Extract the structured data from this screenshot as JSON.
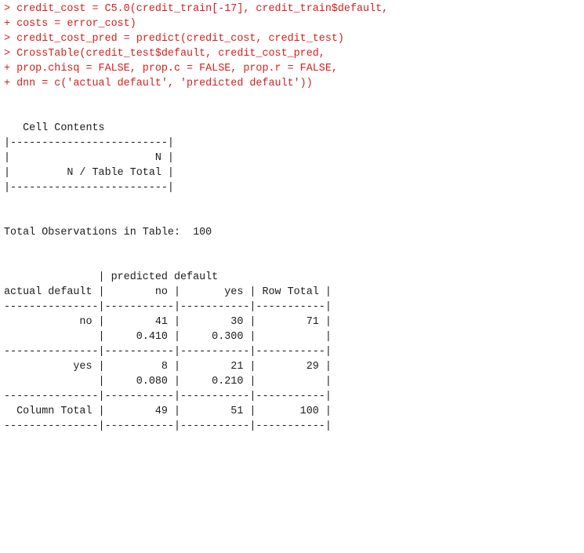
{
  "colors": {
    "command_text": "#d42020",
    "output_text": "#1c1c1c",
    "background": "#ffffff"
  },
  "commands": [
    "> credit_cost = C5.0(credit_train[-17], credit_train$default,",
    "+ costs = error_cost)",
    "> credit_cost_pred = predict(credit_cost, credit_test)",
    "> CrossTable(credit_test$default, credit_cost_pred,",
    "+ prop.chisq = FALSE, prop.c = FALSE, prop.r = FALSE,",
    "+ dnn = c('actual default', 'predicted default'))"
  ],
  "output": [
    "",
    "",
    "   Cell Contents",
    "|-------------------------|",
    "|                       N |",
    "|         N / Table Total |",
    "|-------------------------|",
    "",
    "",
    "Total Observations in Table:  100",
    "",
    "",
    "               | predicted default",
    "actual default |        no |       yes | Row Total |",
    "---------------|-----------|-----------|-----------|",
    "            no |        41 |        30 |        71 |",
    "               |     0.410 |     0.300 |           |",
    "---------------|-----------|-----------|-----------|",
    "           yes |         8 |        21 |        29 |",
    "               |     0.080 |     0.210 |           |",
    "---------------|-----------|-----------|-----------|",
    "  Column Total |        49 |        51 |       100 |",
    "---------------|-----------|-----------|-----------|"
  ]
}
